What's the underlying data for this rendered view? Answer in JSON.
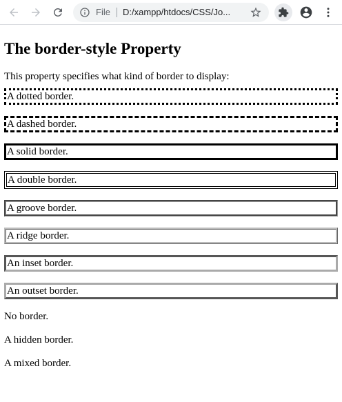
{
  "browser": {
    "scheme_label": "File",
    "url": "D:/xampp/htdocs/CSS/Jo...",
    "icons": [
      "back-arrow-icon",
      "forward-arrow-icon",
      "reload-icon",
      "info-icon",
      "star-icon",
      "puzzle-icon",
      "profile-icon",
      "kebab-menu-icon"
    ]
  },
  "page": {
    "heading": "The border-style Property",
    "intro": "This property specifies what kind of border to display:",
    "paragraphs": [
      "A dotted border.",
      "A dashed border.",
      "A solid border.",
      "A double border.",
      "A groove border.",
      "A ridge border.",
      "An inset border.",
      "An outset border.",
      "No border.",
      "A hidden border.",
      "A mixed border."
    ]
  }
}
